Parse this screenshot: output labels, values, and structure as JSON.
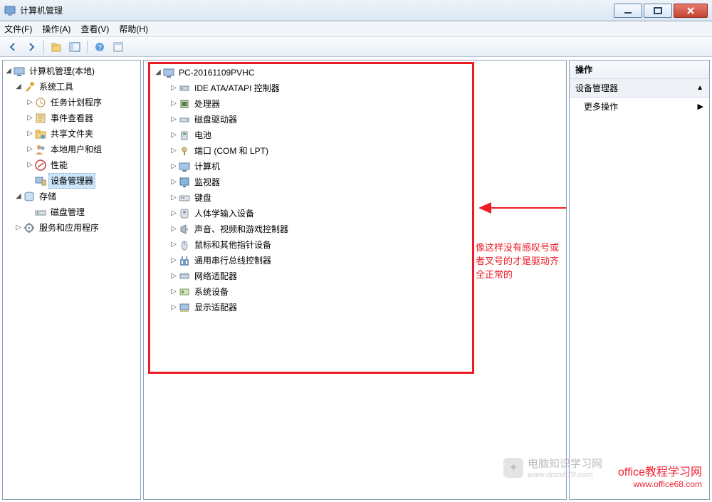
{
  "window": {
    "title": "计算机管理"
  },
  "menubar": {
    "file": "文件(F)",
    "action": "操作(A)",
    "view": "查看(V)",
    "help": "帮助(H)"
  },
  "leftTree": {
    "root": "计算机管理(本地)",
    "sysTools": "系统工具",
    "taskScheduler": "任务计划程序",
    "eventViewer": "事件查看器",
    "sharedFolders": "共享文件夹",
    "localUsers": "本地用户和组",
    "performance": "性能",
    "deviceManager": "设备管理器",
    "storage": "存储",
    "diskMgmt": "磁盘管理",
    "services": "服务和应用程序"
  },
  "deviceTree": {
    "root": "PC-20161109PVHC",
    "items": [
      "IDE ATA/ATAPI 控制器",
      "处理器",
      "磁盘驱动器",
      "电池",
      "端口 (COM 和 LPT)",
      "计算机",
      "监视器",
      "键盘",
      "人体学输入设备",
      "声音、视频和游戏控制器",
      "鼠标和其他指针设备",
      "通用串行总线控制器",
      "网络适配器",
      "系统设备",
      "显示适配器"
    ]
  },
  "annotation": {
    "note": "像这样没有感叹号或者叉号的才是驱动齐全正常的"
  },
  "rightPanel": {
    "header": "操作",
    "subheader": "设备管理器",
    "moreActions": "更多操作"
  },
  "watermark1": {
    "line1": "电脑知识学习网",
    "line2": "www.dnzs678.com"
  },
  "watermark2": {
    "line1": "office教程学习网",
    "line2": "www.office68.com"
  }
}
